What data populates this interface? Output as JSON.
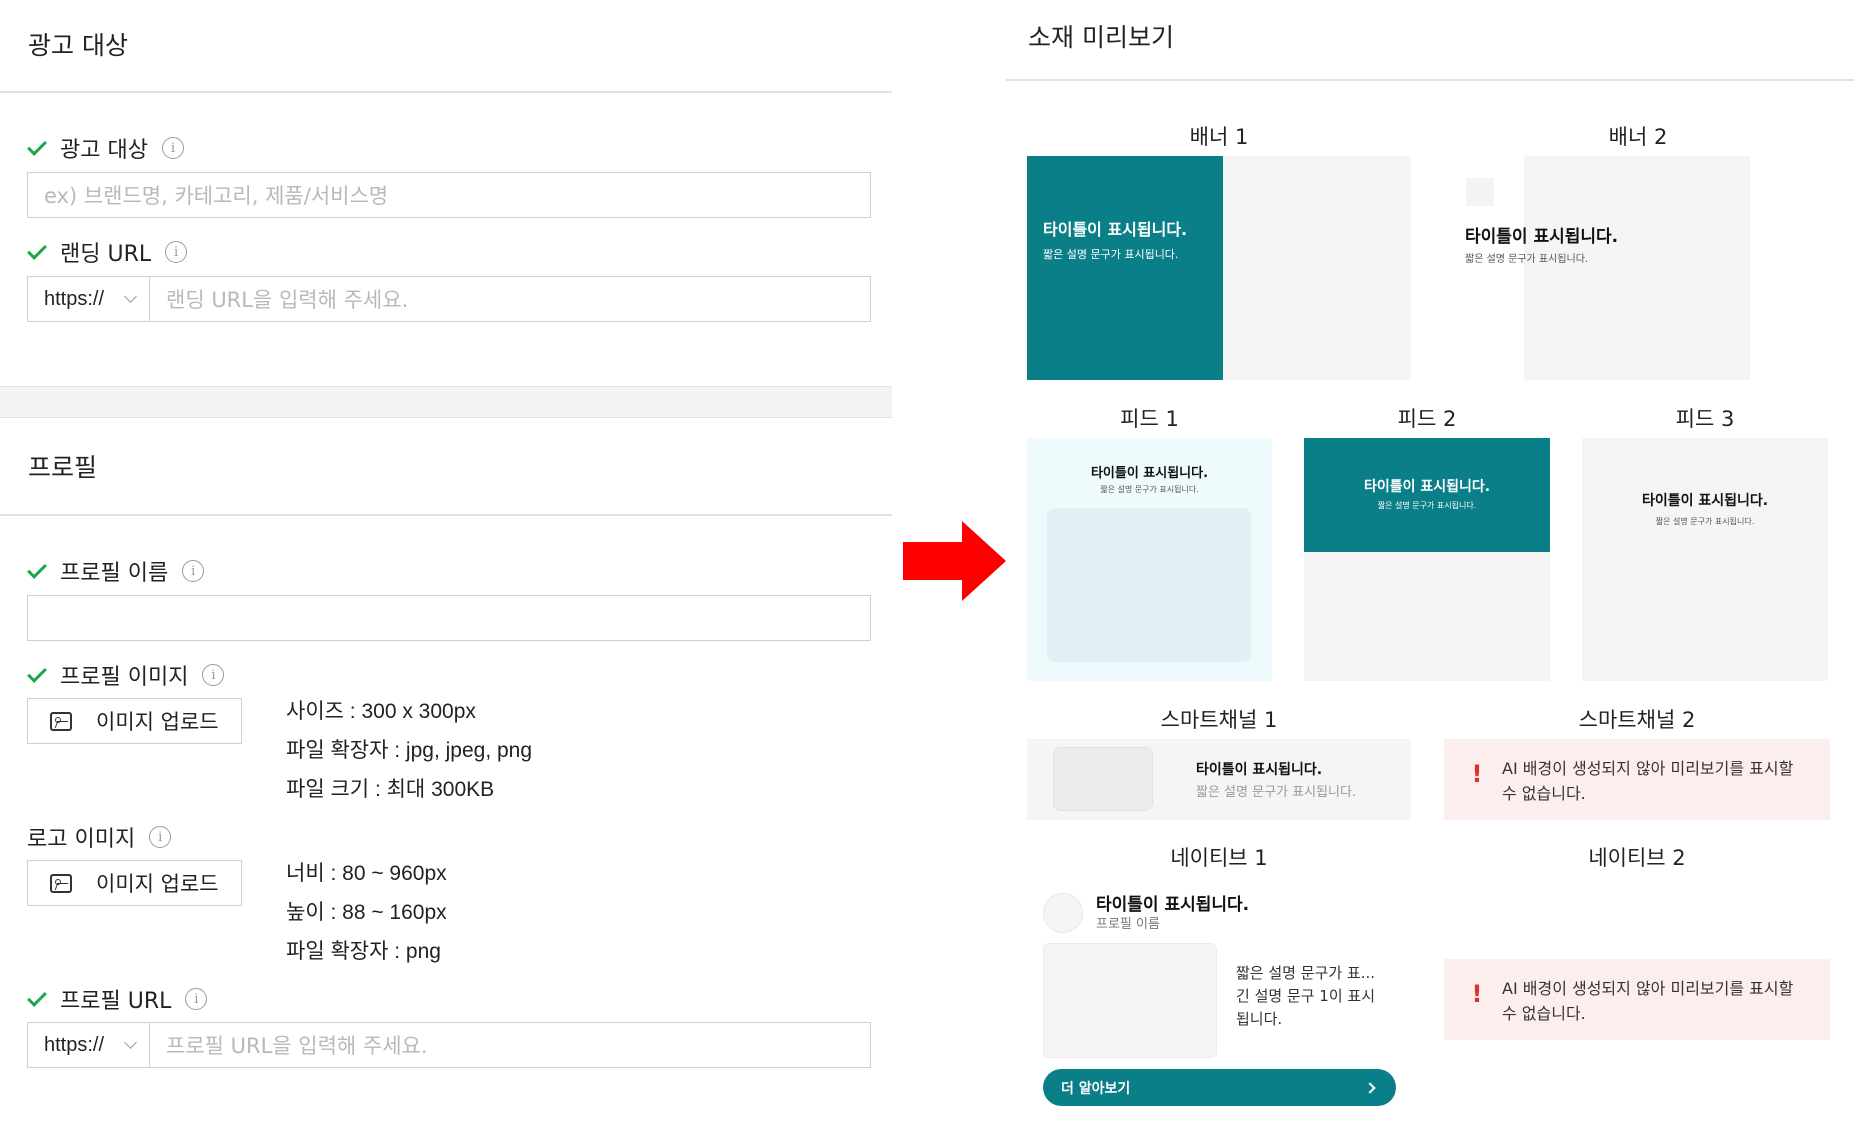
{
  "target_section": {
    "title": "광고 대상",
    "target_field": {
      "label": "광고 대상",
      "placeholder": "ex) 브랜드명, 카테고리, 제품/서비스명"
    },
    "landing_url": {
      "label": "랜딩 URL",
      "protocol": "https://",
      "placeholder": "랜딩 URL을 입력해 주세요."
    }
  },
  "profile_section": {
    "title": "프로필",
    "profile_name": {
      "label": "프로필 이름",
      "value": ""
    },
    "profile_image": {
      "label": "프로필 이미지",
      "upload_label": "이미지 업로드",
      "specs": [
        "사이즈 : 300 x 300px",
        "파일 확장자 : jpg, jpeg, png",
        "파일 크기 : 최대 300KB"
      ]
    },
    "logo_image": {
      "label": "로고 이미지",
      "upload_label": "이미지 업로드",
      "specs": [
        "너비 : 80 ~ 960px",
        "높이 : 88 ~ 160px",
        "파일 확장자 : png"
      ]
    },
    "profile_url": {
      "label": "프로필 URL",
      "protocol": "https://",
      "placeholder": "프로필 URL을 입력해 주세요."
    }
  },
  "info_glyph": "i",
  "preview": {
    "title": "소재 미리보기",
    "sample_title": "타이틀이 표시됩니다.",
    "sample_sub": "짧은 설명 문구가 표시됩니다.",
    "banner1": {
      "label": "배너 1"
    },
    "banner2": {
      "label": "배너 2"
    },
    "feed1": {
      "label": "피드 1"
    },
    "feed2": {
      "label": "피드 2"
    },
    "feed3": {
      "label": "피드 3"
    },
    "smart1": {
      "label": "스마트채널 1"
    },
    "smart2": {
      "label": "스마트채널 2",
      "error": "AI 배경이 생성되지 않아 미리보기를 표시할 수 없습니다."
    },
    "native1": {
      "label": "네이티브 1",
      "profile_name": "프로필 이름",
      "desc_lines": [
        "짧은 설명 문구가 표...",
        "긴 설명 문구 1이 표시",
        "됩니다."
      ],
      "cta": "더 알아보기"
    },
    "native2": {
      "label": "네이티브 2",
      "error": "AI 배경이 생성되지 않아 미리보기를 표시할 수 없습니다."
    }
  },
  "colors": {
    "teal": "#0a7f88",
    "check_green": "#1aa84a",
    "arrow_red": "#ff0000",
    "error_bg": "#fdeeee",
    "error_mark": "#e03131"
  }
}
